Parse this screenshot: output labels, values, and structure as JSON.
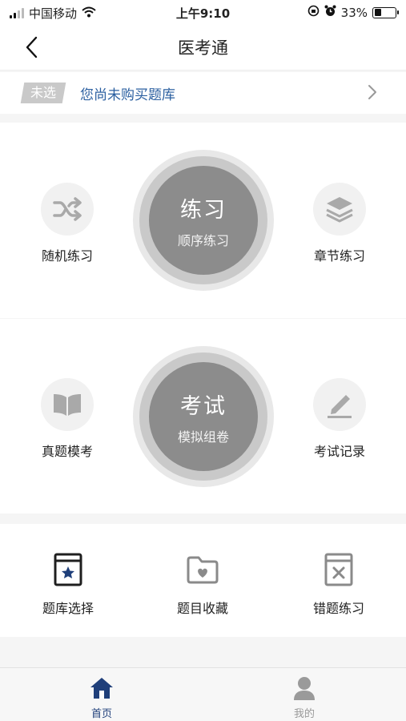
{
  "status_bar": {
    "carrier": "中国移动",
    "time": "上午9:10",
    "battery": "33%",
    "battery_level": 0.33
  },
  "nav": {
    "title": "医考通"
  },
  "bank": {
    "badge": "未选",
    "text": "您尚未购买题库"
  },
  "practice": {
    "title": "练习",
    "subtitle": "顺序练习",
    "left_label": "随机练习",
    "right_label": "章节练习"
  },
  "exam": {
    "title": "考试",
    "subtitle": "模拟组卷",
    "left_label": "真题模考",
    "right_label": "考试记录"
  },
  "tools": [
    {
      "label": "题库选择"
    },
    {
      "label": "题目收藏"
    },
    {
      "label": "错题练习"
    }
  ],
  "tabs": [
    {
      "label": "首页",
      "active": true
    },
    {
      "label": "我的",
      "active": false
    }
  ],
  "colors": {
    "accent": "#1f3f7a",
    "link": "#2b5fa0",
    "inactive": "#9a9a9a"
  }
}
